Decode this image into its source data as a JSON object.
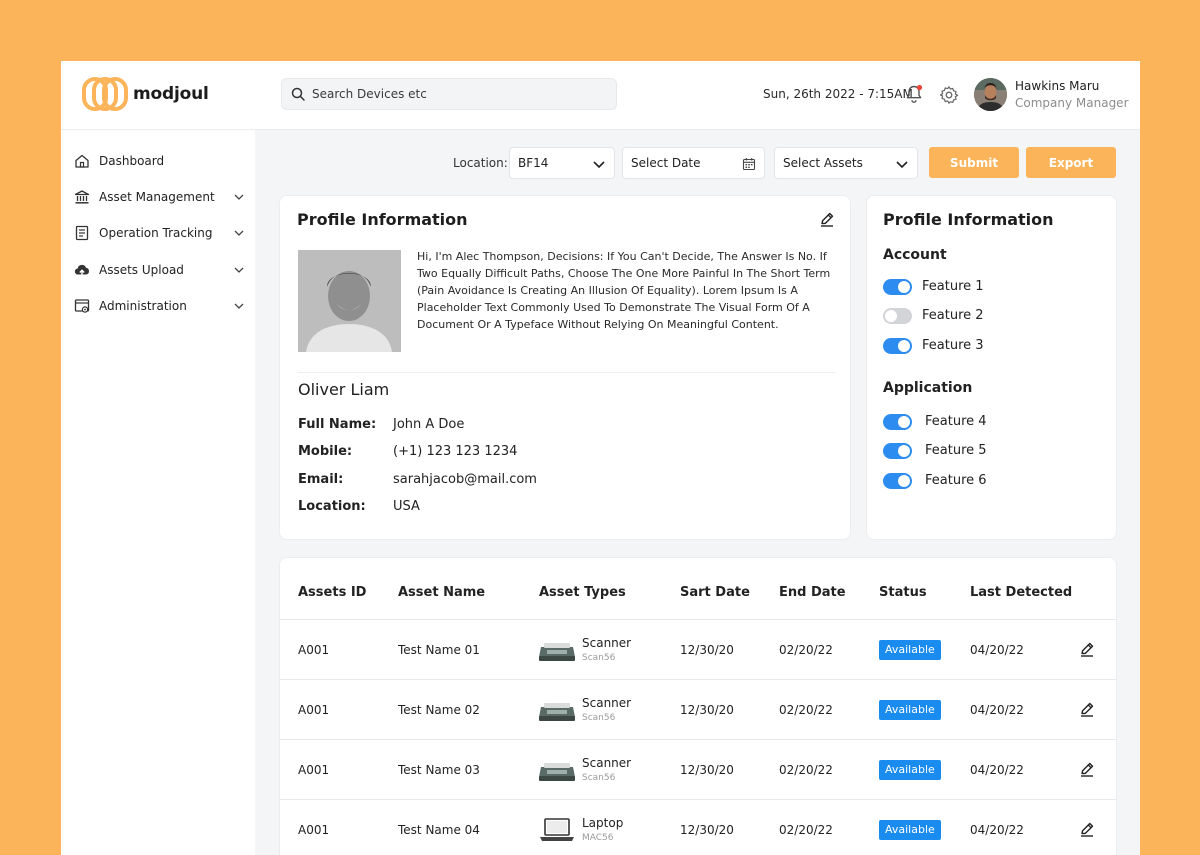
{
  "app": {
    "name": "modjoul"
  },
  "colors": {
    "accent": "#FBB45A",
    "primary_blue": "#2D8CF0",
    "badge_blue": "#1A8CF0",
    "notification_dot": "#F04438"
  },
  "header": {
    "search_placeholder": "Search Devices etc",
    "datetime": "Sun, 26th 2022 - 7:15AM",
    "user": {
      "name": "Hawkins Maru",
      "role": "Company Manager"
    }
  },
  "sidebar": {
    "items": [
      {
        "label": "Dashboard",
        "icon": "home-icon",
        "has_submenu": false
      },
      {
        "label": "Asset Management",
        "icon": "bank-icon",
        "has_submenu": true
      },
      {
        "label": "Operation Tracking",
        "icon": "clipboard-icon",
        "has_submenu": true
      },
      {
        "label": "Assets Upload",
        "icon": "cloud-upload-icon",
        "has_submenu": true
      },
      {
        "label": "Administration",
        "icon": "admin-settings-icon",
        "has_submenu": true
      }
    ]
  },
  "filters": {
    "location_label": "Location:",
    "location_value": "BF14",
    "date_placeholder": "Select Date",
    "assets_placeholder": "Select Assets",
    "submit_label": "Submit",
    "export_label": "Export"
  },
  "profile": {
    "title": "Profile Information",
    "bio": "Hi, I'm Alec Thompson, Decisions: If You Can't Decide, The Answer Is No. If Two Equally Difficult Paths, Choose The One More Painful In The Short Term (Pain Avoidance Is Creating An Illusion Of Equality). Lorem Ipsum Is A Placeholder Text Commonly Used To Demonstrate The Visual Form Of A Document Or A Typeface Without Relying On Meaningful Content.",
    "name": "Oliver Liam",
    "fields": [
      {
        "label": "Full Name:",
        "value": "John A Doe"
      },
      {
        "label": "Mobile:",
        "value": "(+1) 123 123 1234"
      },
      {
        "label": "Email:",
        "value": "sarahjacob@mail.com"
      },
      {
        "label": "Location:",
        "value": "USA"
      }
    ]
  },
  "settings": {
    "title": "Profile Information",
    "account_label": "Account",
    "account_features": [
      {
        "label": "Feature 1",
        "on": true
      },
      {
        "label": "Feature 2",
        "on": false
      },
      {
        "label": "Feature 3",
        "on": true
      }
    ],
    "application_label": "Application",
    "application_features": [
      {
        "label": "Feature 4",
        "on": true
      },
      {
        "label": "Feature 5",
        "on": true
      },
      {
        "label": "Feature 6",
        "on": true
      }
    ]
  },
  "table": {
    "headers": [
      "Assets ID",
      "Asset Name",
      "Asset Types",
      "Sart Date",
      "End Date",
      "Status",
      "Last Detected"
    ],
    "rows": [
      {
        "id": "A001",
        "name": "Test Name 01",
        "type": "Scanner",
        "type_code": "Scan56",
        "type_icon": "scanner-icon",
        "start": "12/30/20",
        "end": "02/20/22",
        "status": "Available",
        "last": "04/20/22"
      },
      {
        "id": "A001",
        "name": "Test Name 02",
        "type": "Scanner",
        "type_code": "Scan56",
        "type_icon": "scanner-icon",
        "start": "12/30/20",
        "end": "02/20/22",
        "status": "Available",
        "last": "04/20/22"
      },
      {
        "id": "A001",
        "name": "Test Name 03",
        "type": "Scanner",
        "type_code": "Scan56",
        "type_icon": "scanner-icon",
        "start": "12/30/20",
        "end": "02/20/22",
        "status": "Available",
        "last": "04/20/22"
      },
      {
        "id": "A001",
        "name": "Test Name 04",
        "type": "Laptop",
        "type_code": "MAC56",
        "type_icon": "laptop-icon",
        "start": "12/30/20",
        "end": "02/20/22",
        "status": "Available",
        "last": "04/20/22"
      }
    ]
  }
}
